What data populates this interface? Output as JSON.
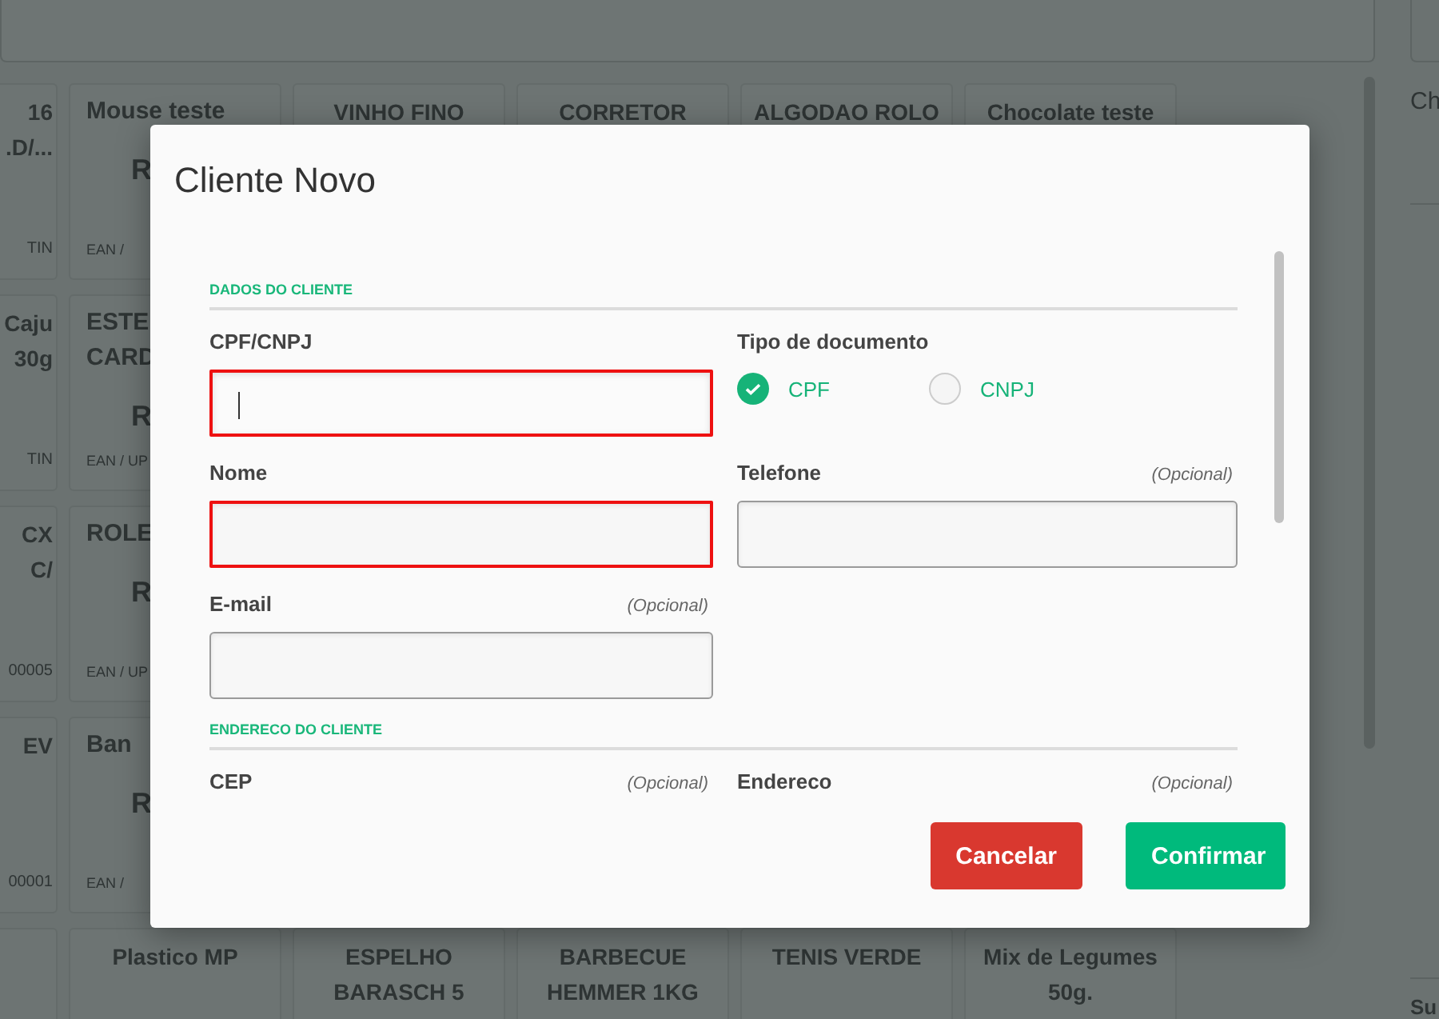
{
  "product_grid": {
    "rows": [
      {
        "cards": [
          {
            "kind": "edge",
            "lines": [
              {
                "kind": "name",
                "text": "16"
              },
              {
                "kind": "name",
                "text": ".D/..."
              },
              {
                "kind": "code",
                "text": "TIN"
              }
            ]
          },
          {
            "kind": "partial",
            "lines": [
              {
                "kind": "name",
                "text": "Mouse teste"
              },
              {
                "kind": "price",
                "text": "R"
              },
              {
                "kind": "code",
                "text": "EAN /"
              }
            ]
          },
          {
            "kind": "full",
            "lines": [
              {
                "kind": "name",
                "text": "VINHO FINO"
              }
            ]
          },
          {
            "kind": "full",
            "lines": [
              {
                "kind": "name",
                "text": "CORRETOR"
              }
            ]
          },
          {
            "kind": "full",
            "lines": [
              {
                "kind": "name",
                "text": "ALGODAO ROLO"
              }
            ]
          },
          {
            "kind": "full",
            "lines": [
              {
                "kind": "name",
                "text": "Chocolate teste"
              }
            ]
          }
        ]
      },
      {
        "cards": [
          {
            "kind": "edge",
            "lines": [
              {
                "kind": "name",
                "text": "Caju"
              },
              {
                "kind": "name",
                "text": "30g"
              },
              {
                "kind": "code",
                "text": "TIN"
              }
            ]
          },
          {
            "kind": "partial",
            "lines": [
              {
                "kind": "name",
                "text": "ESTE"
              },
              {
                "kind": "name",
                "text": "CARD"
              },
              {
                "kind": "price",
                "text": "R"
              },
              {
                "kind": "code",
                "text": "EAN / UP"
              }
            ]
          },
          {
            "kind": "blank"
          },
          {
            "kind": "blank"
          },
          {
            "kind": "blank"
          },
          {
            "kind": "blank"
          }
        ]
      },
      {
        "cards": [
          {
            "kind": "edge",
            "lines": [
              {
                "kind": "name",
                "text": "CX"
              },
              {
                "kind": "name",
                "text": "C/"
              },
              {
                "kind": "code",
                "text": "00005"
              }
            ]
          },
          {
            "kind": "partial",
            "lines": [
              {
                "kind": "name",
                "text": "ROLE"
              },
              {
                "kind": "price",
                "text": "R"
              },
              {
                "kind": "code",
                "text": "EAN / UP"
              }
            ]
          },
          {
            "kind": "blank"
          },
          {
            "kind": "blank"
          },
          {
            "kind": "blank"
          },
          {
            "kind": "blank"
          }
        ]
      },
      {
        "cards": [
          {
            "kind": "edge",
            "lines": [
              {
                "kind": "name",
                "text": "EV"
              },
              {
                "kind": "code",
                "text": "00001"
              }
            ]
          },
          {
            "kind": "partial",
            "lines": [
              {
                "kind": "name",
                "text": "Ban"
              },
              {
                "kind": "price",
                "text": "R"
              },
              {
                "kind": "code",
                "text": "EAN /"
              }
            ]
          },
          {
            "kind": "blank"
          },
          {
            "kind": "blank"
          },
          {
            "kind": "blank"
          },
          {
            "kind": "blank"
          }
        ]
      },
      {
        "cards": [
          {
            "kind": "blank"
          },
          {
            "kind": "full",
            "lines": [
              {
                "kind": "name",
                "text": "Plastico MP"
              }
            ]
          },
          {
            "kind": "full",
            "lines": [
              {
                "kind": "name",
                "text": "ESPELHO BARASCH 5"
              }
            ]
          },
          {
            "kind": "full",
            "lines": [
              {
                "kind": "name",
                "text": "BARBECUE HEMMER 1KG"
              }
            ]
          },
          {
            "kind": "full",
            "lines": [
              {
                "kind": "name",
                "text": "TENIS VERDE"
              }
            ]
          },
          {
            "kind": "full",
            "lines": [
              {
                "kind": "name",
                "text": "Mix de Legumes 50g."
              }
            ]
          }
        ]
      }
    ]
  },
  "side_panel": {
    "top_text": "Ch",
    "bottom_text": "Su"
  },
  "dialog": {
    "title": "Cliente Novo",
    "sections": [
      {
        "title": "DADOS DO CLIENTE",
        "fields": [
          {
            "kind": "text",
            "label": "CPF/CNPJ",
            "invalid": true,
            "focused": true
          },
          {
            "kind": "radio",
            "label": "Tipo de documento",
            "options": [
              {
                "label": "CPF",
                "selected": true
              },
              {
                "label": "CNPJ",
                "selected": false
              }
            ]
          },
          {
            "kind": "text",
            "label": "Nome",
            "invalid": true
          },
          {
            "kind": "text",
            "label": "Telefone",
            "note": "(Opcional)",
            "invalid": false
          },
          {
            "kind": "text",
            "label": "E-mail",
            "note": "(Opcional)",
            "invalid": false
          }
        ]
      },
      {
        "title": "ENDERECO DO CLIENTE",
        "fields": [
          {
            "kind": "text",
            "label": "CEP",
            "note": "(Opcional)"
          },
          {
            "kind": "text",
            "label": "Endereco",
            "note": "(Opcional)"
          }
        ]
      }
    ],
    "buttons": [
      {
        "kind": "cancel",
        "label": "Cancelar"
      },
      {
        "kind": "confirm",
        "label": "Confirmar"
      }
    ]
  }
}
